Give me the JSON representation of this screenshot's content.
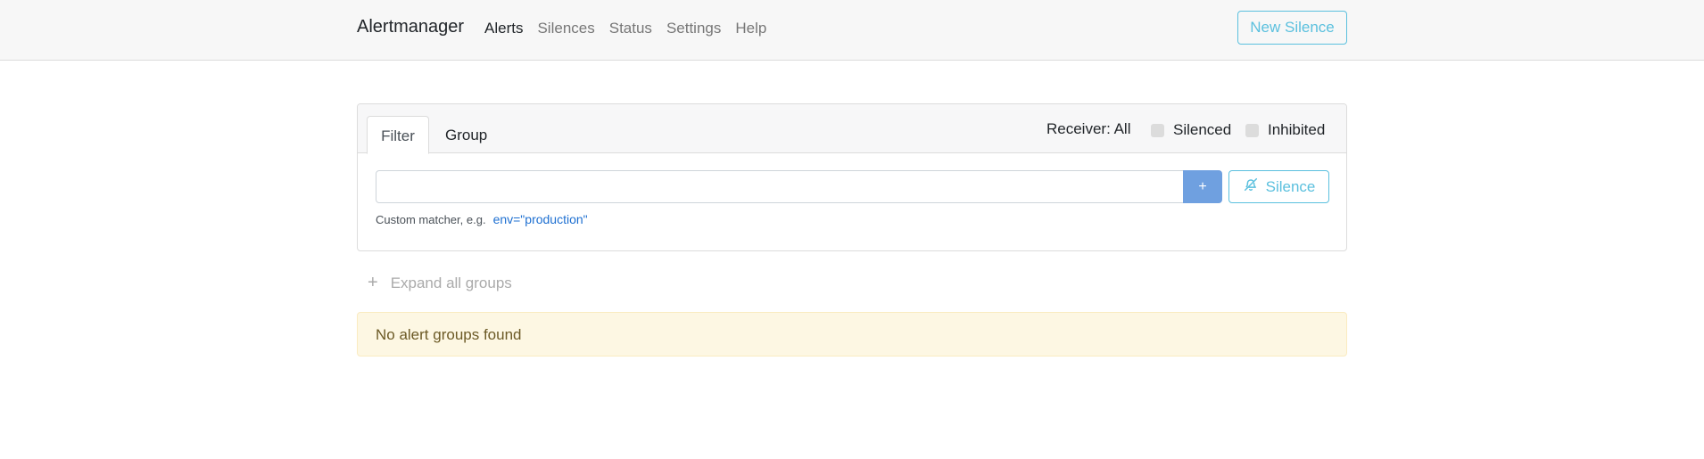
{
  "navbar": {
    "brand": "Alertmanager",
    "items": [
      {
        "label": "Alerts",
        "active": true
      },
      {
        "label": "Silences",
        "active": false
      },
      {
        "label": "Status",
        "active": false
      },
      {
        "label": "Settings",
        "active": false
      },
      {
        "label": "Help",
        "active": false
      }
    ],
    "new_silence_label": "New Silence"
  },
  "filter_card": {
    "tabs": [
      {
        "label": "Filter",
        "active": true
      },
      {
        "label": "Group",
        "active": false
      }
    ],
    "receiver_label": "Receiver: All",
    "checkboxes": [
      {
        "label": "Silenced",
        "checked": false
      },
      {
        "label": "Inhibited",
        "checked": false
      }
    ],
    "matcher_input": {
      "value": "",
      "placeholder": ""
    },
    "add_label": "+",
    "silence_label": "Silence",
    "hint_text": "Custom matcher, e.g.",
    "hint_example": "env=\"production\""
  },
  "expand_all_label": "Expand all groups",
  "alert_message": "No alert groups found",
  "colors": {
    "accent": "#5bc0de",
    "primary_button": "#6fa0e0",
    "link": "#1d6fd1",
    "warning_bg": "#fdf7e3"
  },
  "icons": {
    "silence": "bell-slash-icon",
    "expand": "plus-icon"
  }
}
